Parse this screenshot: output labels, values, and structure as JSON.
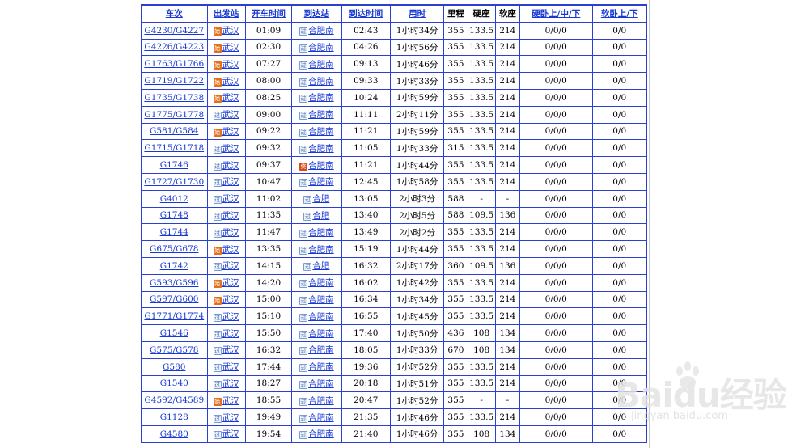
{
  "headers": [
    "车次",
    "出发站",
    "开车时间",
    "到达站",
    "到达时间",
    "用时",
    "里程",
    "硬座",
    "软座",
    "硬卧上/中/下",
    "软卧上/下"
  ],
  "rows": [
    {
      "train": "G4230/G4227",
      "from": "武汉",
      "from_type": "始",
      "dep": "01:09",
      "to": "合肥南",
      "to_type": "过",
      "arr": "02:43",
      "dur": "1小时34分",
      "km": "355",
      "hard": "133.5",
      "soft": "214",
      "hsleep": "0/0/0",
      "ssleep": "0/0"
    },
    {
      "train": "G4226/G4223",
      "from": "武汉",
      "from_type": "始",
      "dep": "02:30",
      "to": "合肥南",
      "to_type": "过",
      "arr": "04:26",
      "dur": "1小时56分",
      "km": "355",
      "hard": "133.5",
      "soft": "214",
      "hsleep": "0/0/0",
      "ssleep": "0/0"
    },
    {
      "train": "G1763/G1766",
      "from": "武汉",
      "from_type": "始",
      "dep": "07:27",
      "to": "合肥南",
      "to_type": "过",
      "arr": "09:13",
      "dur": "1小时46分",
      "km": "355",
      "hard": "133.5",
      "soft": "214",
      "hsleep": "0/0/0",
      "ssleep": "0/0"
    },
    {
      "train": "G1719/G1722",
      "from": "武汉",
      "from_type": "始",
      "dep": "08:00",
      "to": "合肥南",
      "to_type": "过",
      "arr": "09:33",
      "dur": "1小时33分",
      "km": "355",
      "hard": "133.5",
      "soft": "214",
      "hsleep": "0/0/0",
      "ssleep": "0/0"
    },
    {
      "train": "G1735/G1738",
      "from": "武汉",
      "from_type": "始",
      "dep": "08:25",
      "to": "合肥南",
      "to_type": "过",
      "arr": "10:24",
      "dur": "1小时59分",
      "km": "355",
      "hard": "133.5",
      "soft": "214",
      "hsleep": "0/0/0",
      "ssleep": "0/0"
    },
    {
      "train": "G1775/G1778",
      "from": "武汉",
      "from_type": "过",
      "dep": "09:00",
      "to": "合肥南",
      "to_type": "过",
      "arr": "11:11",
      "dur": "2小时11分",
      "km": "355",
      "hard": "133.5",
      "soft": "214",
      "hsleep": "0/0/0",
      "ssleep": "0/0"
    },
    {
      "train": "G581/G584",
      "from": "武汉",
      "from_type": "始",
      "dep": "09:22",
      "to": "合肥南",
      "to_type": "过",
      "arr": "11:21",
      "dur": "1小时59分",
      "km": "355",
      "hard": "133.5",
      "soft": "214",
      "hsleep": "0/0/0",
      "ssleep": "0/0"
    },
    {
      "train": "G1715/G1718",
      "from": "武汉",
      "from_type": "过",
      "dep": "09:32",
      "to": "合肥南",
      "to_type": "过",
      "arr": "11:05",
      "dur": "1小时33分",
      "km": "315",
      "hard": "133.5",
      "soft": "214",
      "hsleep": "0/0/0",
      "ssleep": "0/0"
    },
    {
      "train": "G1746",
      "from": "武汉",
      "from_type": "过",
      "dep": "09:37",
      "to": "合肥南",
      "to_type": "终",
      "arr": "11:21",
      "dur": "1小时44分",
      "km": "355",
      "hard": "133.5",
      "soft": "214",
      "hsleep": "0/0/0",
      "ssleep": "0/0"
    },
    {
      "train": "G1727/G1730",
      "from": "武汉",
      "from_type": "过",
      "dep": "10:47",
      "to": "合肥南",
      "to_type": "过",
      "arr": "12:45",
      "dur": "1小时58分",
      "km": "355",
      "hard": "133.5",
      "soft": "214",
      "hsleep": "0/0/0",
      "ssleep": "0/0"
    },
    {
      "train": "G4012",
      "from": "武汉",
      "from_type": "过",
      "dep": "11:02",
      "to": "合肥",
      "to_type": "过",
      "arr": "13:05",
      "dur": "2小时3分",
      "km": "588",
      "hard": "-",
      "soft": "-",
      "hsleep": "0/0/0",
      "ssleep": "0/0"
    },
    {
      "train": "G1748",
      "from": "武汉",
      "from_type": "过",
      "dep": "11:35",
      "to": "合肥",
      "to_type": "过",
      "arr": "13:40",
      "dur": "2小时5分",
      "km": "588",
      "hard": "109.5",
      "soft": "136",
      "hsleep": "0/0/0",
      "ssleep": "0/0"
    },
    {
      "train": "G1744",
      "from": "武汉",
      "from_type": "过",
      "dep": "11:47",
      "to": "合肥南",
      "to_type": "过",
      "arr": "13:49",
      "dur": "2小时2分",
      "km": "355",
      "hard": "133.5",
      "soft": "214",
      "hsleep": "0/0/0",
      "ssleep": "0/0"
    },
    {
      "train": "G675/G678",
      "from": "武汉",
      "from_type": "始",
      "dep": "13:35",
      "to": "合肥南",
      "to_type": "过",
      "arr": "15:19",
      "dur": "1小时44分",
      "km": "355",
      "hard": "133.5",
      "soft": "214",
      "hsleep": "0/0/0",
      "ssleep": "0/0"
    },
    {
      "train": "G1742",
      "from": "武汉",
      "from_type": "过",
      "dep": "14:15",
      "to": "合肥",
      "to_type": "过",
      "arr": "16:32",
      "dur": "2小时17分",
      "km": "360",
      "hard": "109.5",
      "soft": "136",
      "hsleep": "0/0/0",
      "ssleep": "0/0"
    },
    {
      "train": "G593/G596",
      "from": "武汉",
      "from_type": "始",
      "dep": "14:20",
      "to": "合肥南",
      "to_type": "过",
      "arr": "16:02",
      "dur": "1小时42分",
      "km": "355",
      "hard": "133.5",
      "soft": "214",
      "hsleep": "0/0/0",
      "ssleep": "0/0"
    },
    {
      "train": "G597/G600",
      "from": "武汉",
      "from_type": "始",
      "dep": "15:00",
      "to": "合肥南",
      "to_type": "过",
      "arr": "16:34",
      "dur": "1小时34分",
      "km": "355",
      "hard": "133.5",
      "soft": "214",
      "hsleep": "0/0/0",
      "ssleep": "0/0"
    },
    {
      "train": "G1771/G1774",
      "from": "武汉",
      "from_type": "过",
      "dep": "15:10",
      "to": "合肥南",
      "to_type": "过",
      "arr": "16:55",
      "dur": "1小时45分",
      "km": "355",
      "hard": "133.5",
      "soft": "214",
      "hsleep": "0/0/0",
      "ssleep": "0/0"
    },
    {
      "train": "G1546",
      "from": "武汉",
      "from_type": "过",
      "dep": "15:50",
      "to": "合肥南",
      "to_type": "过",
      "arr": "17:40",
      "dur": "1小时50分",
      "km": "436",
      "hard": "108",
      "soft": "134",
      "hsleep": "0/0/0",
      "ssleep": "0/0"
    },
    {
      "train": "G575/G578",
      "from": "武汉",
      "from_type": "过",
      "dep": "16:32",
      "to": "合肥南",
      "to_type": "过",
      "arr": "18:05",
      "dur": "1小时33分",
      "km": "670",
      "hard": "108",
      "soft": "134",
      "hsleep": "0/0/0",
      "ssleep": "0/0"
    },
    {
      "train": "G580",
      "from": "武汉",
      "from_type": "过",
      "dep": "17:44",
      "to": "合肥南",
      "to_type": "过",
      "arr": "19:36",
      "dur": "1小时52分",
      "km": "355",
      "hard": "133.5",
      "soft": "214",
      "hsleep": "0/0/0",
      "ssleep": "0/0"
    },
    {
      "train": "G1540",
      "from": "武汉",
      "from_type": "过",
      "dep": "18:27",
      "to": "合肥南",
      "to_type": "过",
      "arr": "20:18",
      "dur": "1小时51分",
      "km": "355",
      "hard": "133.5",
      "soft": "214",
      "hsleep": "0/0/0",
      "ssleep": "0/0"
    },
    {
      "train": "G4592/G4589",
      "from": "武汉",
      "from_type": "始",
      "dep": "18:55",
      "to": "合肥南",
      "to_type": "过",
      "arr": "20:47",
      "dur": "1小时52分",
      "km": "355",
      "hard": "-",
      "soft": "-",
      "hsleep": "0/0/0",
      "ssleep": "0/0"
    },
    {
      "train": "G1128",
      "from": "武汉",
      "from_type": "过",
      "dep": "19:49",
      "to": "合肥南",
      "to_type": "过",
      "arr": "21:35",
      "dur": "1小时46分",
      "km": "355",
      "hard": "133.5",
      "soft": "214",
      "hsleep": "0/0/0",
      "ssleep": "0/0"
    },
    {
      "train": "G4580",
      "from": "武汉",
      "from_type": "过",
      "dep": "19:54",
      "to": "合肥南",
      "to_type": "过",
      "arr": "21:40",
      "dur": "1小时46分",
      "km": "355",
      "hard": "108",
      "soft": "134",
      "hsleep": "0/0/0",
      "ssleep": "0/0"
    }
  ],
  "watermark": {
    "logo": "Baidu经验",
    "sub": "jingyan.baidu.com"
  },
  "colors": {
    "border": "#2b3fd0",
    "link": "#1838d6",
    "start_badge": "#e2701d",
    "end_badge": "#d64c1a",
    "pass_badge": "#7c9bd3"
  }
}
